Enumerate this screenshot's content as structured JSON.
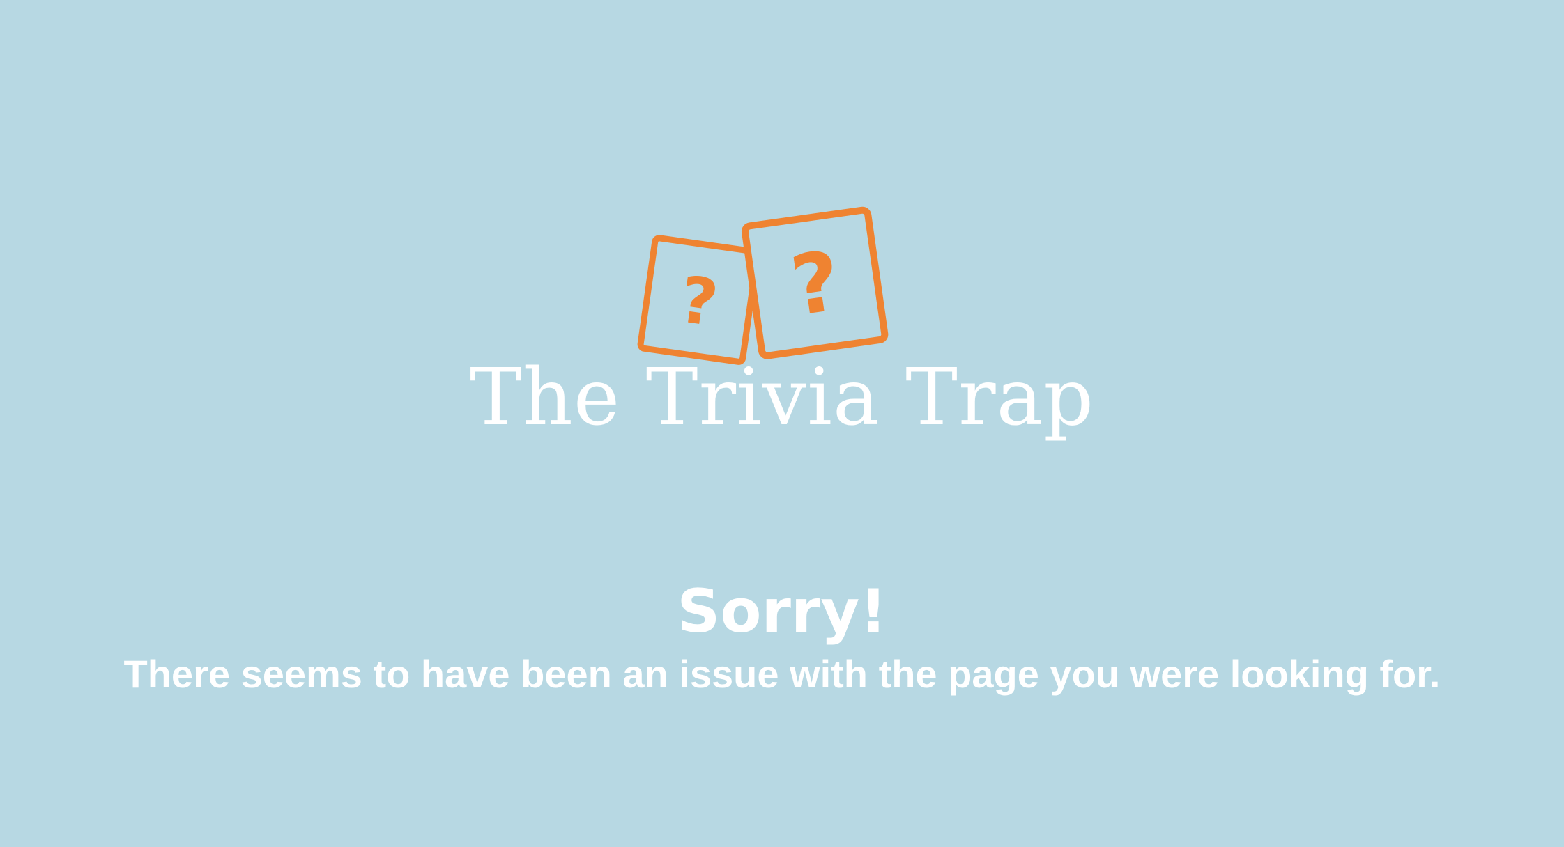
{
  "brand": {
    "name": "The Trivia Trap",
    "logo_icon": "question-cards-icon",
    "accent_color": "#ef8331"
  },
  "error": {
    "title": "Sorry!",
    "message": "There seems to have been an issue with the page you were looking for."
  },
  "colors": {
    "background": "#b7d8e3",
    "text": "#ffffff"
  }
}
